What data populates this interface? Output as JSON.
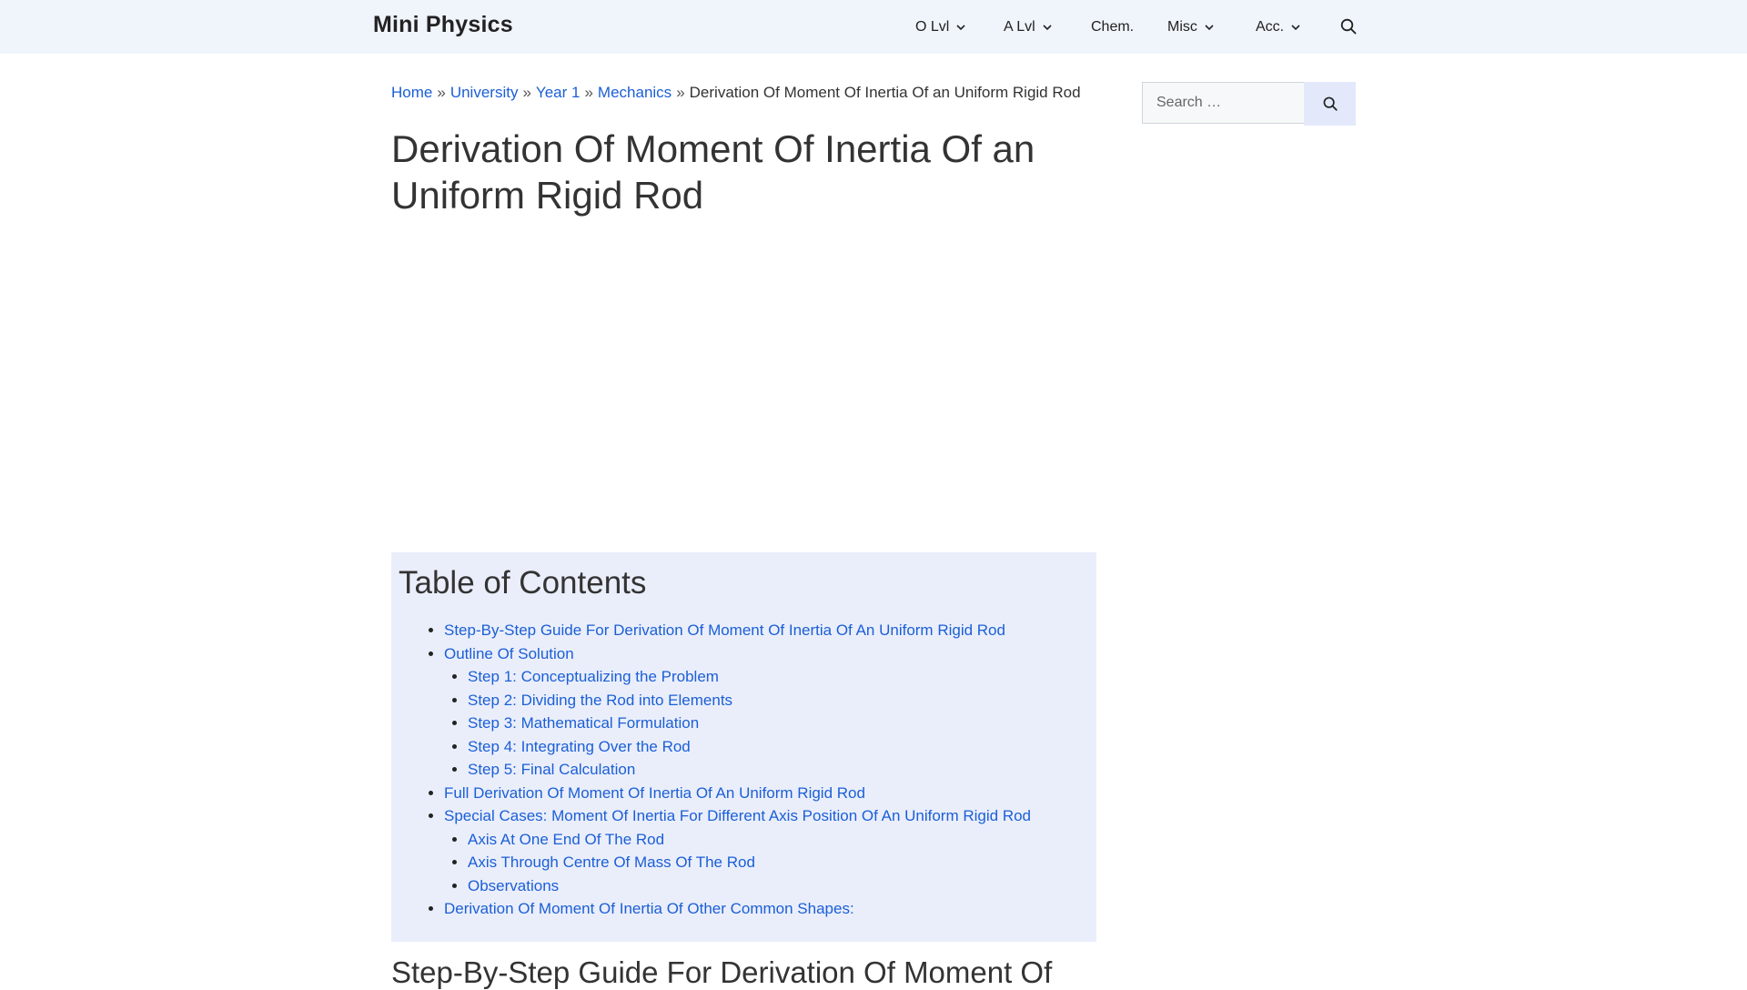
{
  "header": {
    "brand": "Mini Physics",
    "nav": [
      {
        "label": "O Lvl",
        "dropdown": true
      },
      {
        "label": "A Lvl",
        "dropdown": true
      },
      {
        "label": "Chem.",
        "dropdown": false
      },
      {
        "label": "Misc",
        "dropdown": true
      },
      {
        "label": "Acc.",
        "dropdown": true
      }
    ],
    "search_icon": "search-icon"
  },
  "breadcrumb": {
    "items": [
      "Home",
      "University",
      "Year 1",
      "Mechanics"
    ],
    "current": "Derivation Of Moment Of Inertia Of an Uniform Rigid Rod",
    "separator": "»"
  },
  "page": {
    "title": "Derivation Of Moment Of Inertia Of an Uniform Rigid Rod"
  },
  "sidebar": {
    "search_placeholder": "Search …"
  },
  "toc": {
    "title": "Table of Contents",
    "items": [
      {
        "label": "Step-By-Step Guide For Derivation Of Moment Of Inertia Of An Uniform Rigid Rod",
        "children": []
      },
      {
        "label": "Outline Of Solution",
        "children": [
          "Step 1: Conceptualizing the Problem",
          "Step 2: Dividing the Rod into Elements",
          "Step 3: Mathematical Formulation",
          "Step 4: Integrating Over the Rod",
          "Step 5: Final Calculation"
        ]
      },
      {
        "label": "Full Derivation Of Moment Of Inertia Of An Uniform Rigid Rod",
        "children": []
      },
      {
        "label": "Special Cases: Moment Of Inertia For Different Axis Position Of An Uniform Rigid Rod",
        "children": [
          "Axis At One End Of The Rod",
          "Axis Through Centre Of Mass Of The Rod",
          "Observations"
        ]
      },
      {
        "label": "Derivation Of Moment Of Inertia Of Other Common Shapes:",
        "children": []
      }
    ]
  },
  "next_heading": "Step-By-Step Guide For Derivation Of Moment Of",
  "colors": {
    "link": "#1b5fd6",
    "header_bg": "#f0f4fb",
    "toc_bg": "#eaeefb",
    "search_button_bg": "#e3e9fb"
  }
}
